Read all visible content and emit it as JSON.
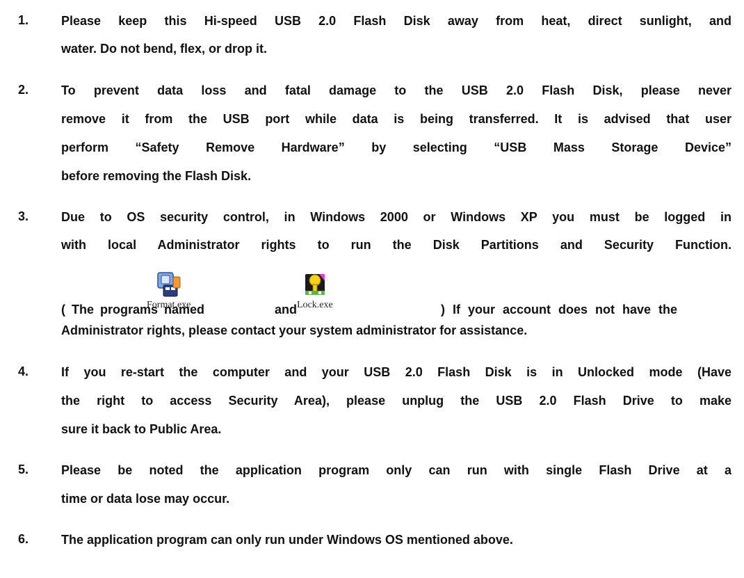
{
  "items": [
    {
      "number": "1.",
      "lines": [
        "Please keep this Hi-speed USB 2.0 Flash Disk away from heat, direct sunlight, and",
        "water. Do not bend, flex, or drop it."
      ]
    },
    {
      "number": "2.",
      "lines": [
        "To prevent data loss and fatal damage to the USB 2.0 Flash Disk, please never",
        "remove it from the USB port while data is being transferred. It is advised that user",
        "perform “Safety Remove Hardware” by selecting “USB Mass Storage Device”",
        "before removing the Flash Disk."
      ]
    },
    {
      "number": "3.",
      "lines": [
        "Due to OS security control, in Windows 2000 or Windows XP you must be logged in",
        "with local Administrator rights to run the Disk Partitions and Security Function."
      ],
      "programs_line": {
        "prefix": "( The programs named",
        "and": "and",
        "suffix": ") If your account does not have the"
      },
      "tail_line": "Administrator rights, please contact your system administrator for assistance."
    },
    {
      "number": "4.",
      "lines": [
        "If you re-start the computer and your USB 2.0 Flash Disk is in Unlocked mode (Have",
        "the right to access Security Area), please unplug the USB 2.0 Flash Drive to make",
        "sure it back to Public Area."
      ]
    },
    {
      "number": "5.",
      "lines": [
        "Please be noted the application program only can run with single Flash Drive at a",
        "time or data lose may occur."
      ]
    },
    {
      "number": "6.",
      "lines": [
        "The application program can only run under Windows OS mentioned above."
      ]
    }
  ],
  "programs": [
    {
      "label": "Format.exe",
      "icon": "format-program-icon"
    },
    {
      "label": "Lock.exe",
      "icon": "lock-program-icon"
    }
  ]
}
